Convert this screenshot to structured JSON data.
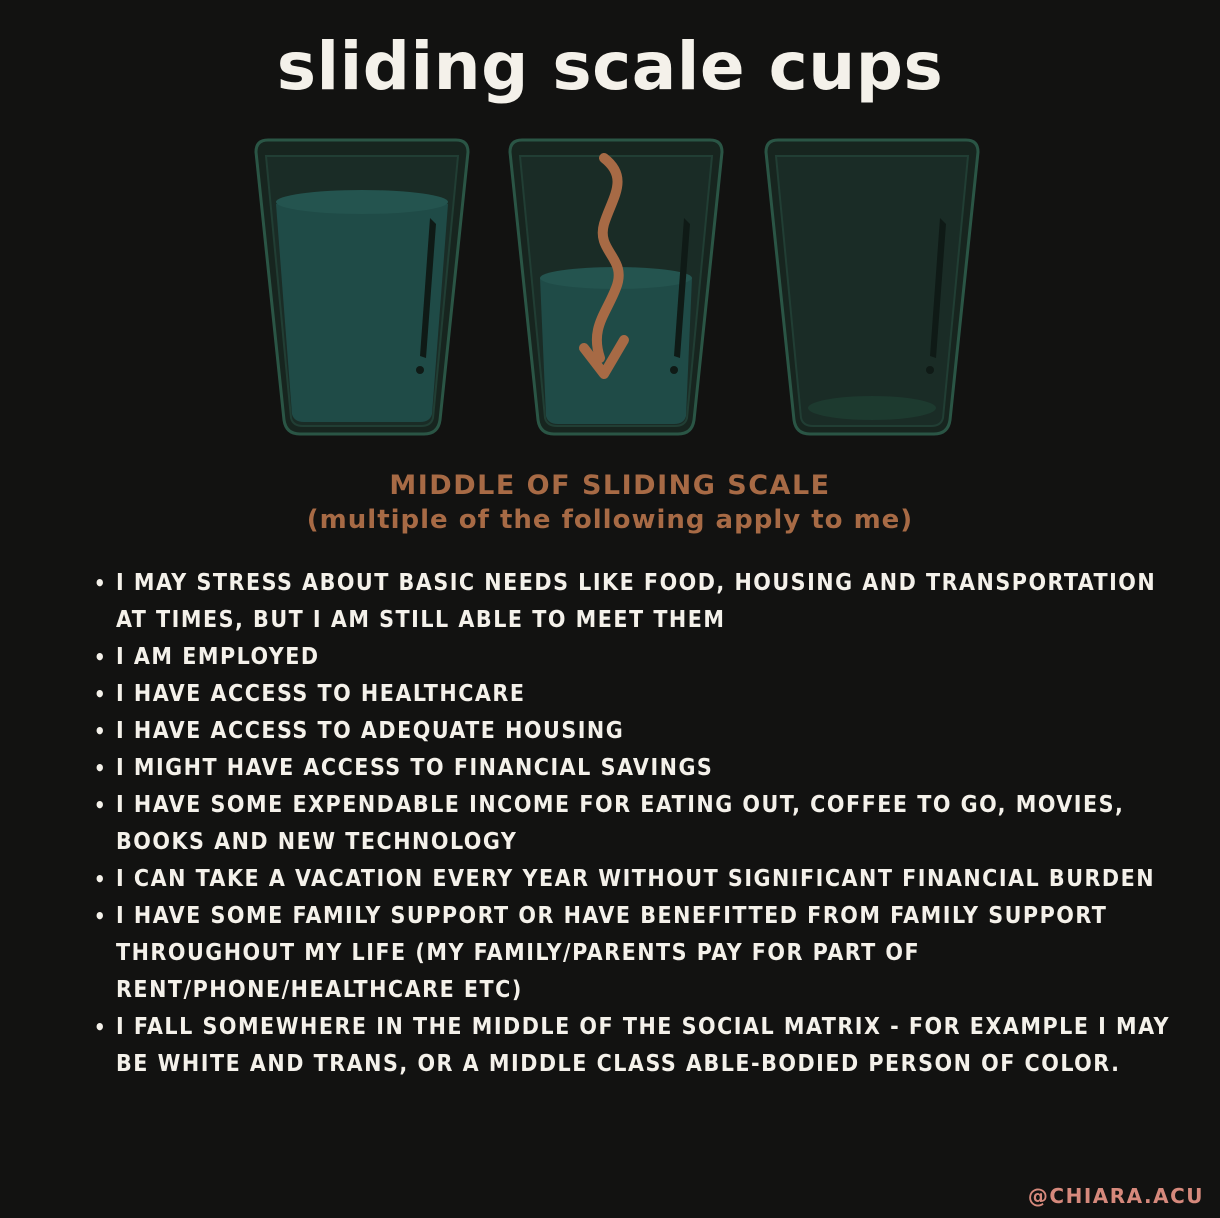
{
  "title": "sliding scale cups",
  "subtitle": {
    "line1": "MIDDLE OF SLIDING SCALE",
    "line2": "(multiple of the following apply to me)"
  },
  "cups": [
    {
      "icon": "full-cup-icon",
      "fill_level": 0.75
    },
    {
      "icon": "half-cup-icon",
      "fill_level": 0.45,
      "arrow": "down-arrow-icon"
    },
    {
      "icon": "empty-cup-icon",
      "fill_level": 0.0
    }
  ],
  "items": [
    "I may stress about basic needs like food, housing and transportation at times, but I am still able to meet them",
    "I am employed",
    "I have access to healthcare",
    "I have access to adequate housing",
    "I might have access to financial savings",
    "I have some expendable income for eating out, coffee to go, movies, books and new technology",
    "I can take a vacation every year without significant financial burden",
    "I have some family support or have benefitted from family support throughout my life (my family/parents pay for part of rent/phone/healthcare etc)",
    "I fall somewhere in the middle of the social matrix - for example I may be white and trans, or a middle class able-bodied person of color."
  ],
  "handle": "@CHIARA.ACU",
  "colors": {
    "background": "#121211",
    "title": "#f4f1ea",
    "accent": "#a76a45",
    "cup_outline": "#234a3d",
    "water": "#1f4b47",
    "handle": "#d6897c"
  }
}
